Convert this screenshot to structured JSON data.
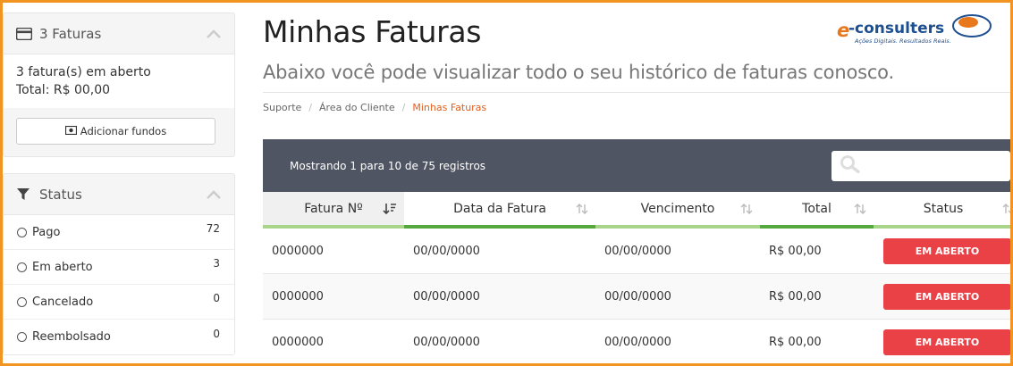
{
  "sidebar": {
    "invoices_panel": {
      "title": "3 Faturas",
      "open_text": "3 fatura(s) em aberto",
      "total_text": "Total: R$ 00,00",
      "add_funds_label": "Adicionar fundos"
    },
    "status_panel": {
      "title": "Status",
      "items": [
        {
          "label": "Pago",
          "count": "72"
        },
        {
          "label": "Em aberto",
          "count": "3"
        },
        {
          "label": "Cancelado",
          "count": "0"
        },
        {
          "label": "Reembolsado",
          "count": "0"
        }
      ]
    }
  },
  "page": {
    "title": "Minhas Faturas",
    "subtitle": "Abaixo você pode visualizar todo o seu histórico de faturas conosco.",
    "breadcrumb": [
      "Suporte",
      "Área do Cliente",
      "Minhas Faturas"
    ]
  },
  "logo": {
    "brand_text": "e-consulters",
    "tagline": "Ações Digitais. Resultados Reais."
  },
  "table": {
    "info": "Mostrando 1 para 10 de 75 registros",
    "search_placeholder": "",
    "columns": [
      "Fatura Nº",
      "Data da Fatura",
      "Vencimento",
      "Total",
      "Status"
    ],
    "rows": [
      {
        "number": "0000000",
        "date": "00/00/0000",
        "due": "00/00/0000",
        "total": "R$ 00,00",
        "status": "EM ABERTO"
      },
      {
        "number": "0000000",
        "date": "00/00/0000",
        "due": "00/00/0000",
        "total": "R$ 00,00",
        "status": "EM ABERTO"
      },
      {
        "number": "0000000",
        "date": "00/00/0000",
        "due": "00/00/0000",
        "total": "R$ 00,00",
        "status": "EM ABERTO"
      }
    ]
  },
  "colors": {
    "frame": "#f29422",
    "table_header_bg": "#505563",
    "status_open": "#e94146",
    "breadcrumb_active": "#e05f1d",
    "column_underline": "#a8d58a",
    "logo_orange": "#e8781e",
    "logo_blue": "#1d4f91"
  },
  "icons": {
    "invoices": "credit-card-icon",
    "collapse": "chevron-up-icon",
    "add_funds": "money-icon",
    "status": "filter-icon",
    "search": "search-icon",
    "sort": "sort-icon",
    "sort_active": "sort-desc-icon"
  }
}
